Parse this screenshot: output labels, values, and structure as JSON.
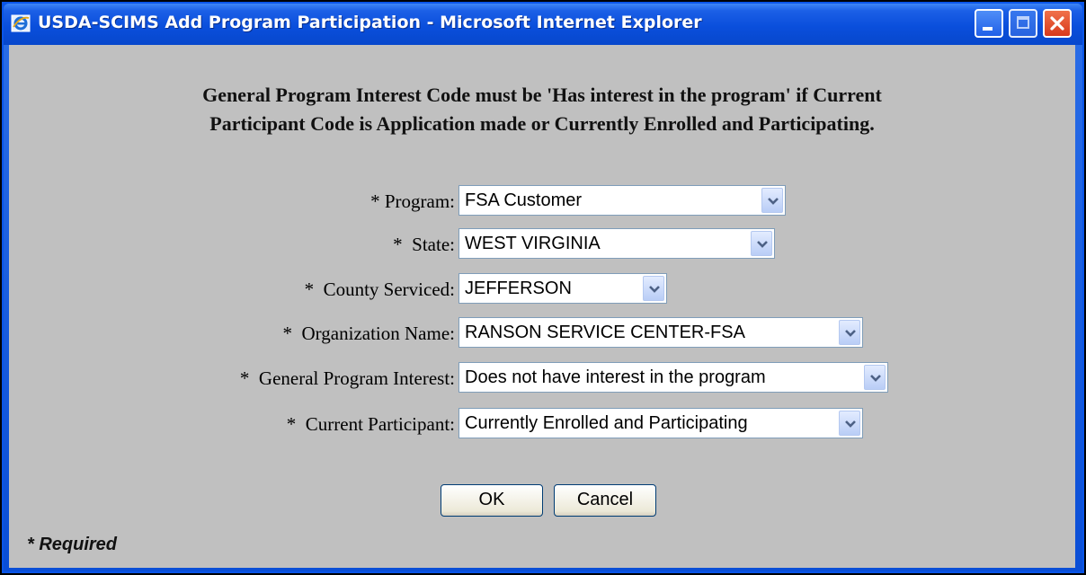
{
  "window": {
    "title": "USDA-SCIMS Add Program Participation - Microsoft Internet Explorer"
  },
  "message": {
    "line1": "General Program Interest Code must be 'Has interest in the program' if Current",
    "line2": "Participant Code is Application made or Currently Enrolled and Participating."
  },
  "form": {
    "program": {
      "label": "* Program:",
      "value": "FSA Customer"
    },
    "state": {
      "label": "*  State:",
      "value": "WEST VIRGINIA"
    },
    "county": {
      "label": "*  County Serviced:",
      "value": "JEFFERSON"
    },
    "organization": {
      "label": "*  Organization Name:",
      "value": "RANSON SERVICE CENTER-FSA"
    },
    "interest": {
      "label": "*  General Program Interest:",
      "value": "Does not have interest in the program"
    },
    "participant": {
      "label": "*  Current Participant:",
      "value": "Currently Enrolled and Participating"
    }
  },
  "buttons": {
    "ok": "OK",
    "cancel": "Cancel"
  },
  "footer": {
    "required_note": "* Required"
  },
  "colors": {
    "titlebar": "#0a4fdc",
    "client": "#c0c0c0",
    "close": "#d8391c"
  }
}
